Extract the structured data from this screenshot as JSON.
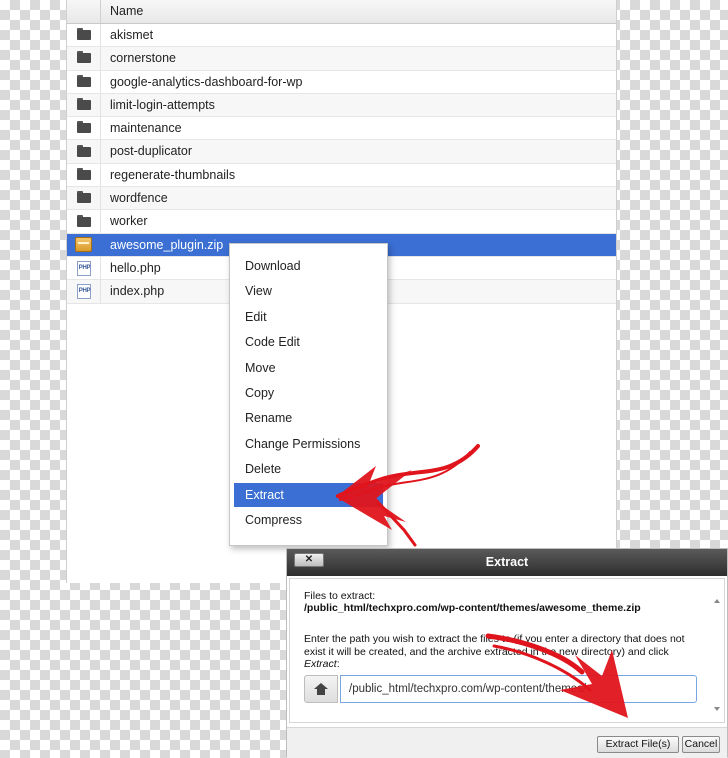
{
  "file_manager": {
    "column_header": "Name",
    "files": [
      {
        "name": "akismet",
        "icon": "folder-icon"
      },
      {
        "name": "cornerstone",
        "icon": "folder-icon"
      },
      {
        "name": "google-analytics-dashboard-for-wp",
        "icon": "folder-icon"
      },
      {
        "name": "limit-login-attempts",
        "icon": "folder-icon"
      },
      {
        "name": "maintenance",
        "icon": "folder-icon"
      },
      {
        "name": "post-duplicator",
        "icon": "folder-icon"
      },
      {
        "name": "regenerate-thumbnails",
        "icon": "folder-icon"
      },
      {
        "name": "wordfence",
        "icon": "folder-icon"
      },
      {
        "name": "worker",
        "icon": "folder-icon"
      },
      {
        "name": "awesome_plugin.zip",
        "icon": "zip-icon",
        "selected": true
      },
      {
        "name": "hello.php",
        "icon": "php-file-icon"
      },
      {
        "name": "index.php",
        "icon": "php-file-icon"
      }
    ],
    "php_icon_text": "PHP"
  },
  "context_menu": {
    "items": [
      "Download",
      "View",
      "Edit",
      "Code Edit",
      "Move",
      "Copy",
      "Rename",
      "Change Permissions",
      "Delete",
      "Extract",
      "Compress"
    ],
    "active_item": "Extract"
  },
  "extract_dialog": {
    "title": "Extract",
    "close_label": "✕",
    "files_label": "Files to extract:",
    "files_path": "/public_html/techxpro.com/wp-content/themes/awesome_theme.zip",
    "instructions": "Enter the path you wish to extract the files to (if you enter a directory that does not exist it will be created, and the archive extracted in the new directory) and click Extract:",
    "path_value": "/public_html/techxpro.com/wp-content/themes/",
    "extract_button": "Extract File(s)",
    "cancel_button": "Cancel"
  },
  "colors": {
    "selection": "#3b6fd3",
    "annotation_arrow": "#e0141c"
  }
}
